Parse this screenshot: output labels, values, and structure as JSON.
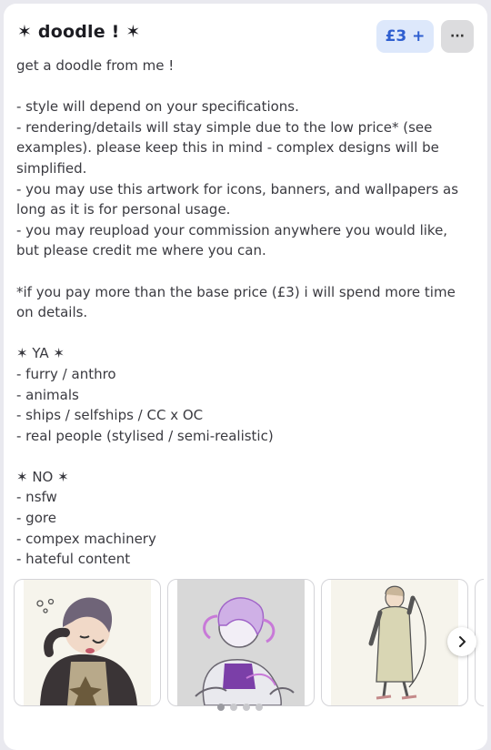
{
  "listing": {
    "title": "✶ doodle ! ✶",
    "price_label": "£3 +",
    "more_label": "···",
    "description": "get a doodle from me !\n\n- style will depend on your specifications.\n- rendering/details will stay simple due to the low price* (see examples). please keep this in mind - complex designs will be simplified.\n- you may use this artwork for icons, banners, and wallpapers as long as it is for personal usage.\n- you may reupload your commission anywhere you would like, but please credit me where you can.\n\n*if you pay more than the base price (£3) i will spend more time on details.\n\n✶ YA ✶\n- furry / anthro\n- animals\n- ships / selfships / CC x OC\n- real people (stylised / semi-realistic)\n\n✶ NO ✶\n- nsfw\n- gore\n- compex machinery\n- hateful content"
  },
  "gallery": {
    "images": [
      {
        "icon": "doodle-character-sleepy-image"
      },
      {
        "icon": "doodle-character-purple-image"
      },
      {
        "icon": "doodle-character-fullbody-image"
      }
    ],
    "next_icon": "chevron-right-icon",
    "dots_count": 4,
    "active_dot": 1
  },
  "colors": {
    "price_bg": "#dde8fb",
    "price_text": "#2f5fd0",
    "more_bg": "#dcdcde"
  }
}
